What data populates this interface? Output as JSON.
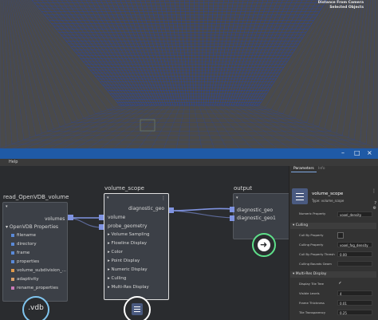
{
  "viewport": {
    "hud_line1": "Distance From Camera",
    "hud_line2": "Selected Objects"
  },
  "menubar": {
    "help": "Help"
  },
  "window_controls": {
    "minimize": "–",
    "maximize": "□",
    "close": "×"
  },
  "node_graph": {
    "read_node": {
      "title": "read_OpenVDB_volume",
      "output_port": "volumes",
      "section": "OpenVDB Properties",
      "properties": [
        "filename",
        "directory",
        "frame",
        "properties",
        "volume_subdivision_...",
        "adaptivity",
        "rename_properties"
      ],
      "badge": ".vdb"
    },
    "scope_node": {
      "title": "volume_scope",
      "input_ports": [
        "volume",
        "probe_geometry"
      ],
      "output_port": "diagnostic_geo",
      "groups": [
        "Volume Sampling",
        "Flowline Display",
        "Color",
        "Point Display",
        "Numeric Display",
        "Culling",
        "Multi-Res Display"
      ]
    },
    "output_node": {
      "title": "output",
      "ports": [
        "diagnostic_geo",
        "diagnostic_geo1"
      ]
    }
  },
  "params_panel": {
    "tabs": [
      "Parameters",
      "Info"
    ],
    "node_name": "volume_scope",
    "node_type": "Type: volume_scope",
    "cut_label": "Numeric Property",
    "cut_value": "voxel_density",
    "culling_section": "Culling",
    "culling_rows": [
      {
        "label": "Cull By Property",
        "value": ""
      },
      {
        "label": "Culling Property",
        "value": "voxel_fog_density"
      },
      {
        "label": "Cull By Property Thresh",
        "value": "0.00"
      },
      {
        "label": "Culling Bounds Geom",
        "value": ""
      }
    ],
    "multires_section": "Multi-Res Display",
    "multires_rows": [
      {
        "label": "Display Tile Tree",
        "value": "✓"
      },
      {
        "label": "Visible Levels",
        "value": "4"
      },
      {
        "label": "Frame Thickness",
        "value": "0.01"
      },
      {
        "label": "Tile Transparency",
        "value": "0.25"
      }
    ]
  },
  "colors": {
    "grid": "#1e46c8",
    "titlebar": "#1f5aa6",
    "vdb_ring": "#7fc4ee",
    "scope_ring": "#ffffff",
    "output_ring": "#5ee08a",
    "wire": "#7f93e0"
  }
}
